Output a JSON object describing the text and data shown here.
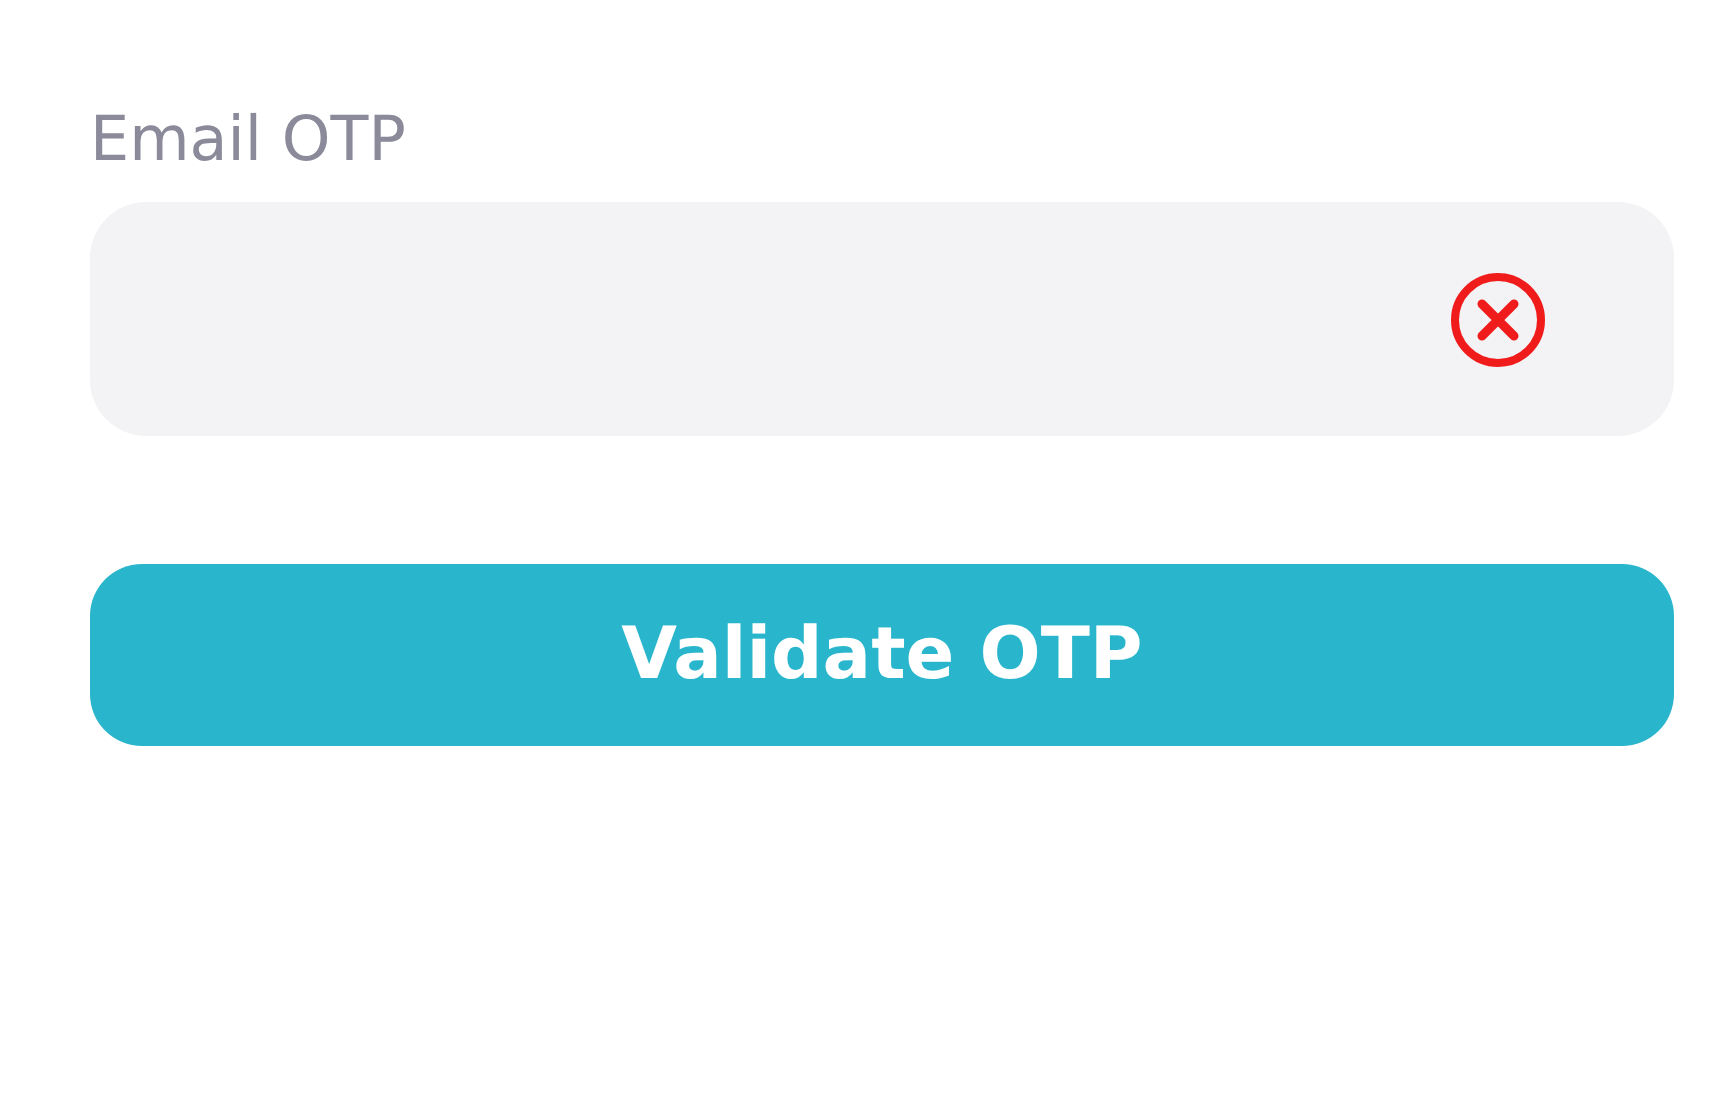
{
  "field": {
    "label": "Email OTP",
    "invalid": true
  },
  "button": {
    "label": "Validate OTP"
  }
}
